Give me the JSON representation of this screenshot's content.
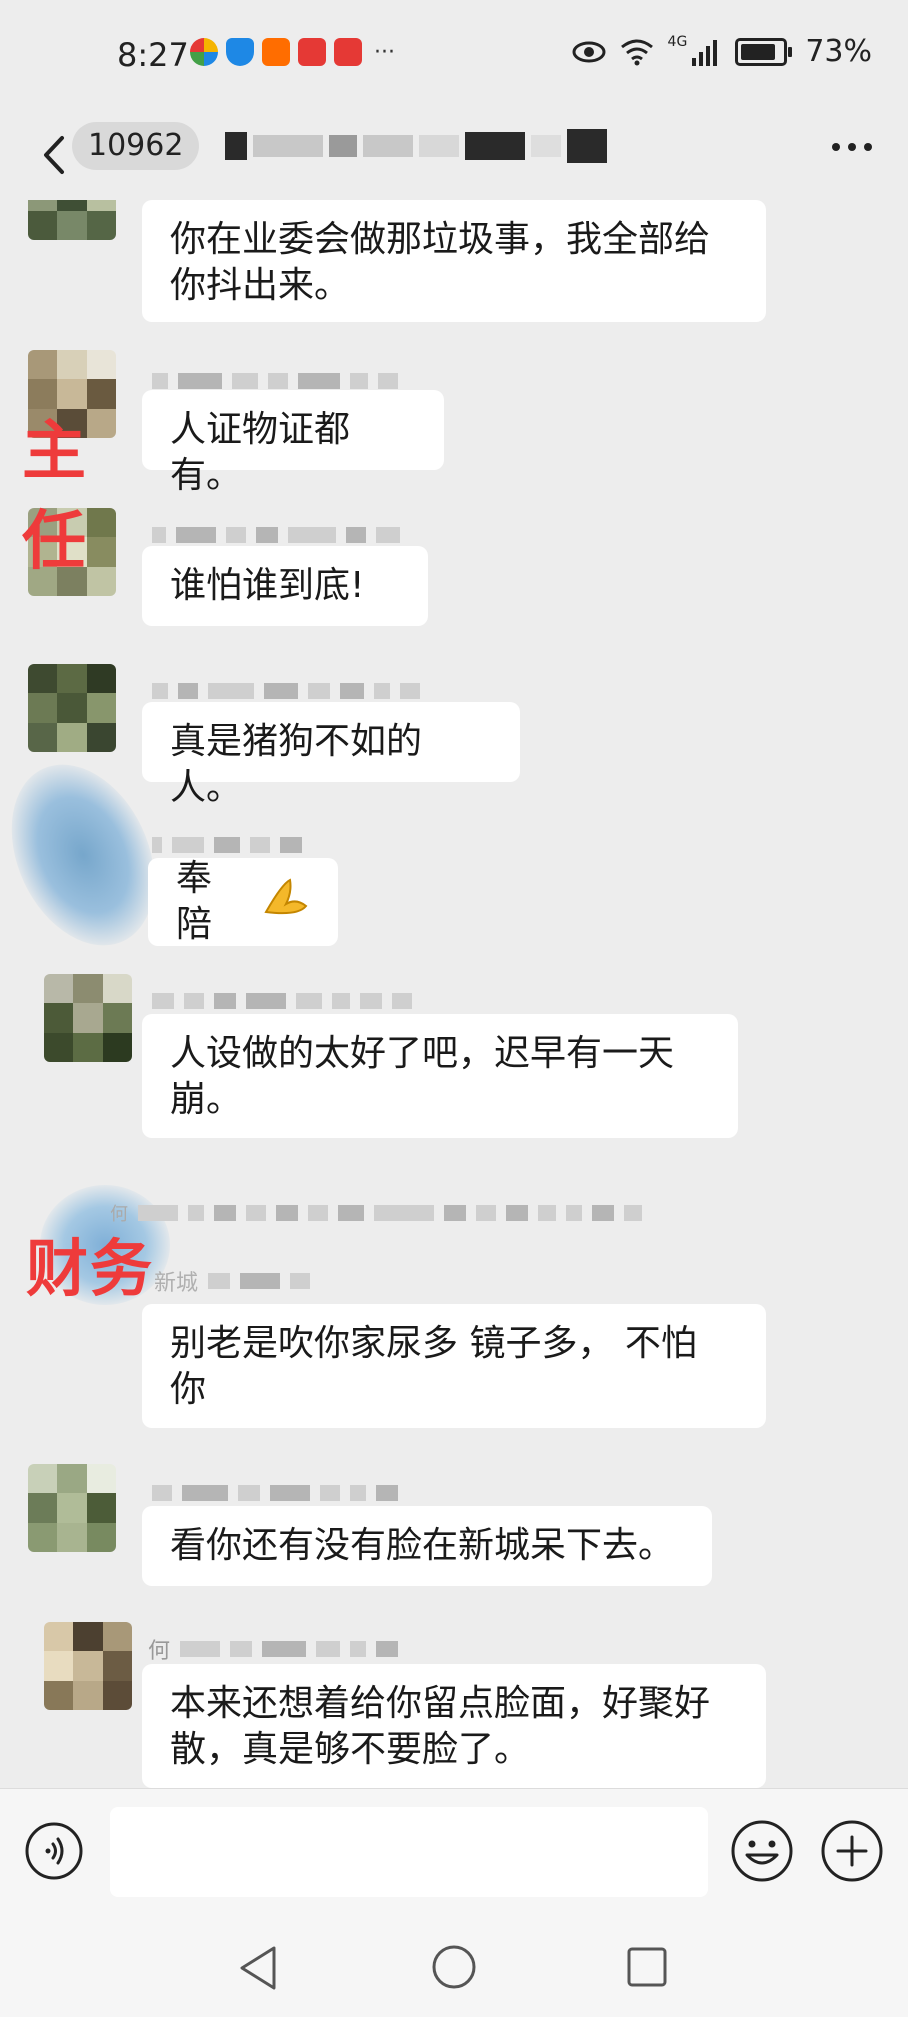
{
  "status_bar": {
    "time": "8:27",
    "network": "4G",
    "battery_percent": "73%",
    "battery_level": 0.73
  },
  "header": {
    "unread_count": "10962",
    "more_label": "···"
  },
  "messages": [
    {
      "text_lines": [
        "你在业委会做那垃圾事，我全部给",
        "你抖出来。"
      ]
    },
    {
      "text_lines": [
        "人证物证都有。"
      ]
    },
    {
      "text_lines": [
        "谁怕谁到底!"
      ]
    },
    {
      "text_lines": [
        "真是猪狗不如的人。"
      ]
    },
    {
      "text_lines": [
        "奉陪"
      ],
      "emoji": "🙏"
    },
    {
      "text_lines": [
        "人设做的太好了吧，迟早有一天",
        "崩。"
      ]
    },
    {
      "text_lines": [
        "别老是吹你家尿多 镜子多， 不怕",
        "你"
      ]
    },
    {
      "text_lines": [
        "看你还有没有脸在新城呆下去。"
      ]
    },
    {
      "text_lines": [
        "本来还想着给你留点脸面，好聚好",
        "散，真是够不要脸了。"
      ]
    }
  ],
  "annotations": {
    "label_1_top": "主",
    "label_1_bottom": "任",
    "label_2": "财务"
  },
  "partial_names": {
    "nick_7_prefix": "何",
    "nick_7_line2": "新城",
    "nick_9_prefix": "何"
  },
  "input": {
    "value": ""
  },
  "colors": {
    "background": "#ededed",
    "bubble": "#ffffff",
    "annotation_red": "#ee3b3b"
  }
}
